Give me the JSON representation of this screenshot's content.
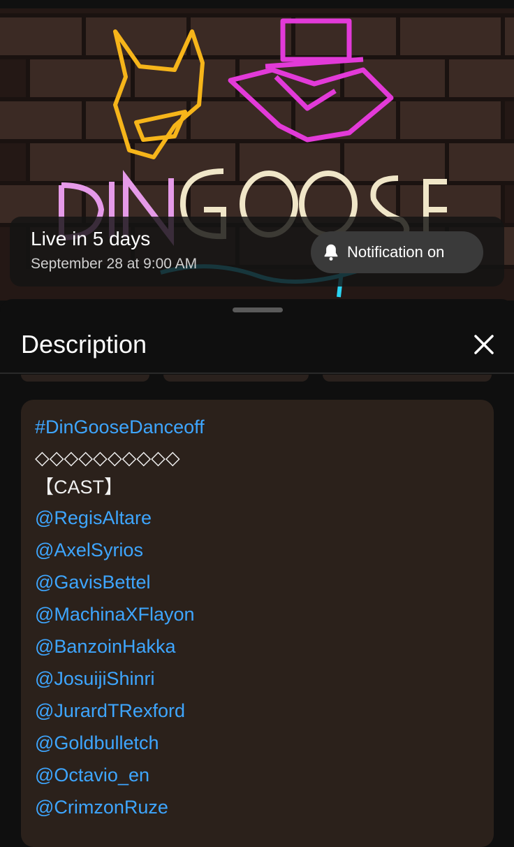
{
  "live": {
    "title": "Live in 5 days",
    "date": "September 28 at 9:00 AM",
    "notification_label": "Notification on"
  },
  "description": {
    "heading": "Description",
    "hashtag": "#DinGooseDanceoff",
    "separator": "◇◇◇◇◇◇◇◇◇◇",
    "cast_label": "【CAST】",
    "cast": [
      "@RegisAltare",
      "@AxelSyrios",
      "@GavisBettel",
      "@MachinaXFlayon",
      "@BanzoinHakka",
      "@JosuijiShinri",
      "@JurardTRexford",
      "@Goldbulletch",
      "@Octavio_en",
      "@CrimzonRuze"
    ]
  },
  "colors": {
    "link": "#3ea6ff",
    "card": "#2b211b",
    "background": "#0f0f0f"
  },
  "icons": {
    "bell": "bell-filled-icon",
    "close": "close-icon"
  }
}
